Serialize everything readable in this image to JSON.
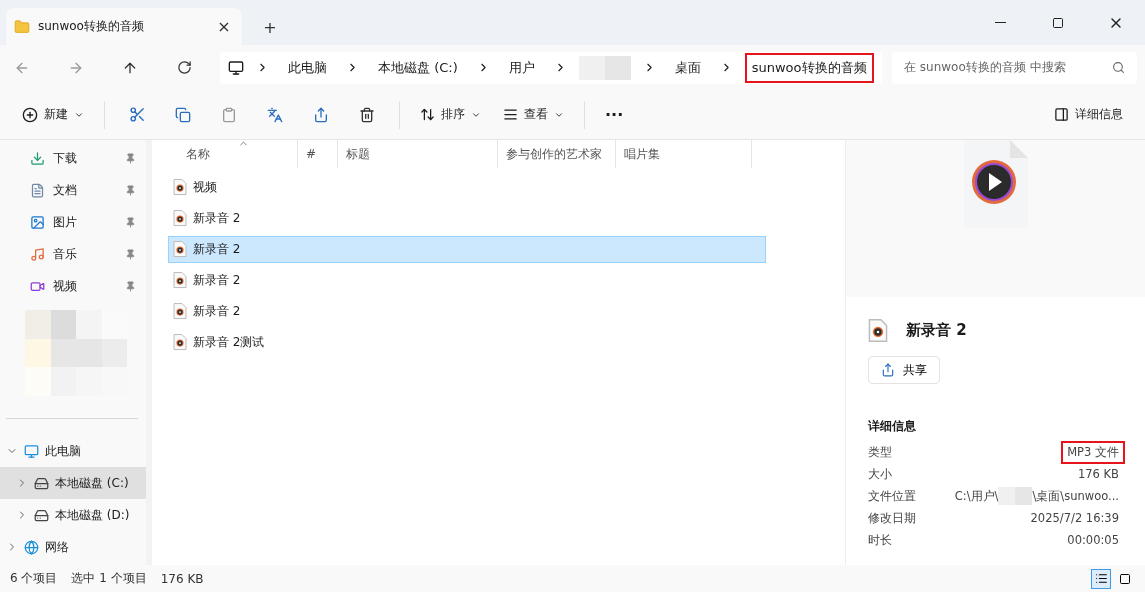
{
  "window": {
    "tab_title": "sunwoo转换的音频",
    "tab_close": "×",
    "new_tab": "+"
  },
  "address_bar": {
    "crumbs": [
      {
        "label": "此电脑",
        "redacted": false,
        "highlighted": false
      },
      {
        "label": "本地磁盘 (C:)",
        "redacted": false,
        "highlighted": false
      },
      {
        "label": "用户",
        "redacted": false,
        "highlighted": false
      },
      {
        "redacted": true,
        "highlighted": false
      },
      {
        "label": "桌面",
        "redacted": false,
        "highlighted": false
      },
      {
        "label": "sunwoo转换的音频",
        "redacted": false,
        "highlighted": true
      }
    ],
    "search_placeholder": "在 sunwoo转换的音频 中搜索"
  },
  "toolbar": {
    "new": "新建",
    "sort": "排序",
    "view": "查看",
    "more": "···",
    "details": "详细信息"
  },
  "sidebar": {
    "quick_access": [
      {
        "label": "下载",
        "kind": "download"
      },
      {
        "label": "文档",
        "kind": "document"
      },
      {
        "label": "图片",
        "kind": "picture"
      },
      {
        "label": "音乐",
        "kind": "music"
      },
      {
        "label": "视频",
        "kind": "video"
      }
    ],
    "tree": [
      {
        "label": "此电脑",
        "kind": "pc",
        "expanded": true,
        "selected": false,
        "children": [
          {
            "label": "本地磁盘 (C:)",
            "kind": "drive",
            "expanded": false,
            "selected": true
          },
          {
            "label": "本地磁盘 (D:)",
            "kind": "drive",
            "expanded": false,
            "selected": false
          }
        ]
      },
      {
        "label": "网络",
        "kind": "network",
        "expanded": false,
        "selected": false
      }
    ]
  },
  "file_list": {
    "columns": [
      "名称",
      "#",
      "标题",
      "参与创作的艺术家",
      "唱片集"
    ],
    "rows": [
      {
        "name": "视频",
        "selected": false
      },
      {
        "name": "新录音 2",
        "selected": false
      },
      {
        "name": "新录音 2",
        "selected": true
      },
      {
        "name": "新录音 2",
        "selected": false
      },
      {
        "name": "新录音 2",
        "selected": false
      },
      {
        "name": "新录音 2测试",
        "selected": false
      }
    ]
  },
  "details_pane": {
    "file_name": "新录音 2",
    "share": "共享",
    "section_title": "详细信息",
    "properties": [
      {
        "label": "类型",
        "value": "MP3 文件",
        "highlighted": true
      },
      {
        "label": "大小",
        "value": "176 KB",
        "highlighted": false
      },
      {
        "label": "文件位置",
        "value": "C:\\用户\\",
        "value_after": "\\桌面\\sunwoo...",
        "highlighted": false
      },
      {
        "label": "修改日期",
        "value": "2025/7/2 16:39",
        "highlighted": false
      },
      {
        "label": "时长",
        "value": "00:00:05",
        "highlighted": false
      }
    ]
  },
  "status_bar": {
    "count": "6 个项目",
    "selection": "选中 1 个项目",
    "size": "176 KB",
    "views": [
      {
        "kind": "details",
        "selected": true
      },
      {
        "kind": "tiles",
        "selected": false
      }
    ]
  }
}
